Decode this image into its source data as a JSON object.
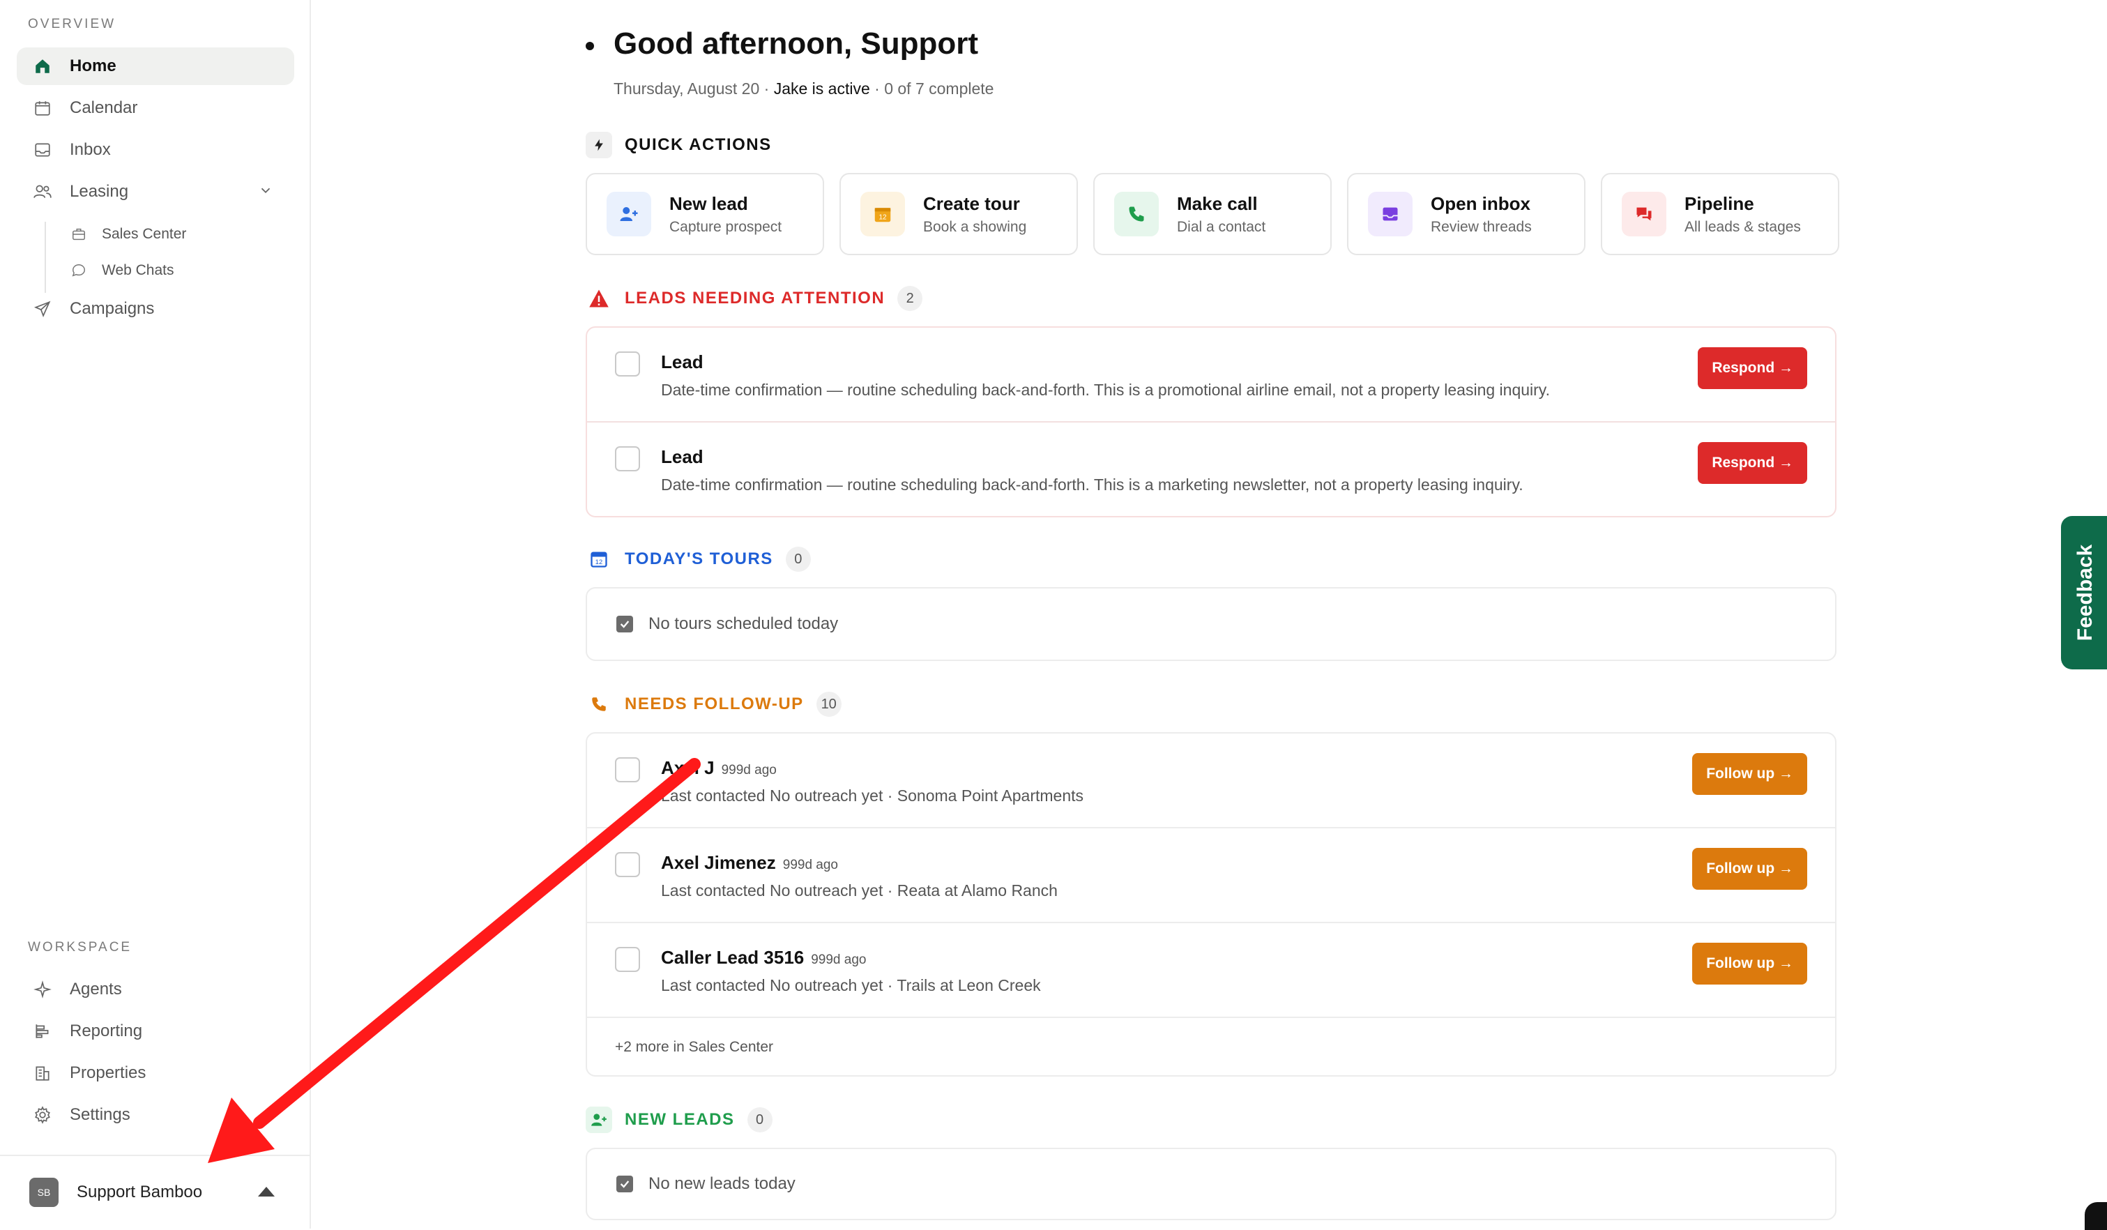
{
  "sidebar": {
    "overview_label": "OVERVIEW",
    "items": [
      {
        "label": "Home"
      },
      {
        "label": "Calendar"
      },
      {
        "label": "Inbox"
      },
      {
        "label": "Leasing"
      },
      {
        "label": "Campaigns"
      }
    ],
    "leasing_sub": [
      {
        "label": "Sales Center"
      },
      {
        "label": "Web Chats"
      }
    ],
    "workspace_label": "WORKSPACE",
    "workspace_items": [
      {
        "label": "Agents"
      },
      {
        "label": "Reporting"
      },
      {
        "label": "Properties"
      },
      {
        "label": "Settings"
      }
    ],
    "user": {
      "initials": "SB",
      "name": "Support Bamboo"
    }
  },
  "header": {
    "greeting": "Good afternoon, Support",
    "date": "Thursday, August 20 · ",
    "active": "Jake is active",
    "progress": " · 0 of 7 complete"
  },
  "quick_actions": {
    "title": "QUICK ACTIONS",
    "items": [
      {
        "title": "New lead",
        "sub": "Capture prospect"
      },
      {
        "title": "Create tour",
        "sub": "Book a showing"
      },
      {
        "title": "Make call",
        "sub": "Dial a contact"
      },
      {
        "title": "Open inbox",
        "sub": "Review threads"
      },
      {
        "title": "Pipeline",
        "sub": "All leads & stages"
      }
    ]
  },
  "attention": {
    "title": "LEADS NEEDING ATTENTION",
    "count": "2",
    "rows": [
      {
        "name": "Lead",
        "desc": "Date-time confirmation — routine scheduling back-and-forth. This is a promotional airline email, not a property leasing inquiry.",
        "action": "Respond →"
      },
      {
        "name": "Lead",
        "desc": "Date-time confirmation — routine scheduling back-and-forth. This is a marketing newsletter, not a property leasing inquiry.",
        "action": "Respond →"
      }
    ]
  },
  "tours": {
    "title": "TODAY'S TOURS",
    "count": "0",
    "empty": "No tours scheduled today"
  },
  "followup": {
    "title": "NEEDS FOLLOW-UP",
    "count": "10",
    "rows": [
      {
        "name": "Axel J",
        "ago": "999d ago",
        "desc": "Last contacted No outreach yet · Sonoma Point Apartments",
        "action": "Follow up →"
      },
      {
        "name": "Axel Jimenez",
        "ago": "999d ago",
        "desc": "Last contacted No outreach yet · Reata at Alamo Ranch",
        "action": "Follow up →"
      },
      {
        "name": "Caller Lead 3516",
        "ago": "999d ago",
        "desc": "Last contacted No outreach yet · Trails at Leon Creek",
        "action": "Follow up →"
      }
    ],
    "more": "+2 more in Sales Center"
  },
  "new_leads": {
    "title": "NEW LEADS",
    "count": "0",
    "empty": "No new leads today"
  },
  "feedback_label": "Feedback",
  "colors": {
    "brand_green": "#0e6b4a",
    "attention_red": "#dd2a2a",
    "tours_blue": "#1f5fd6",
    "followup_orange": "#dc7a0d",
    "new_leads_green": "#1f9d4c",
    "annotation_arrow": "#ff1a1a"
  }
}
